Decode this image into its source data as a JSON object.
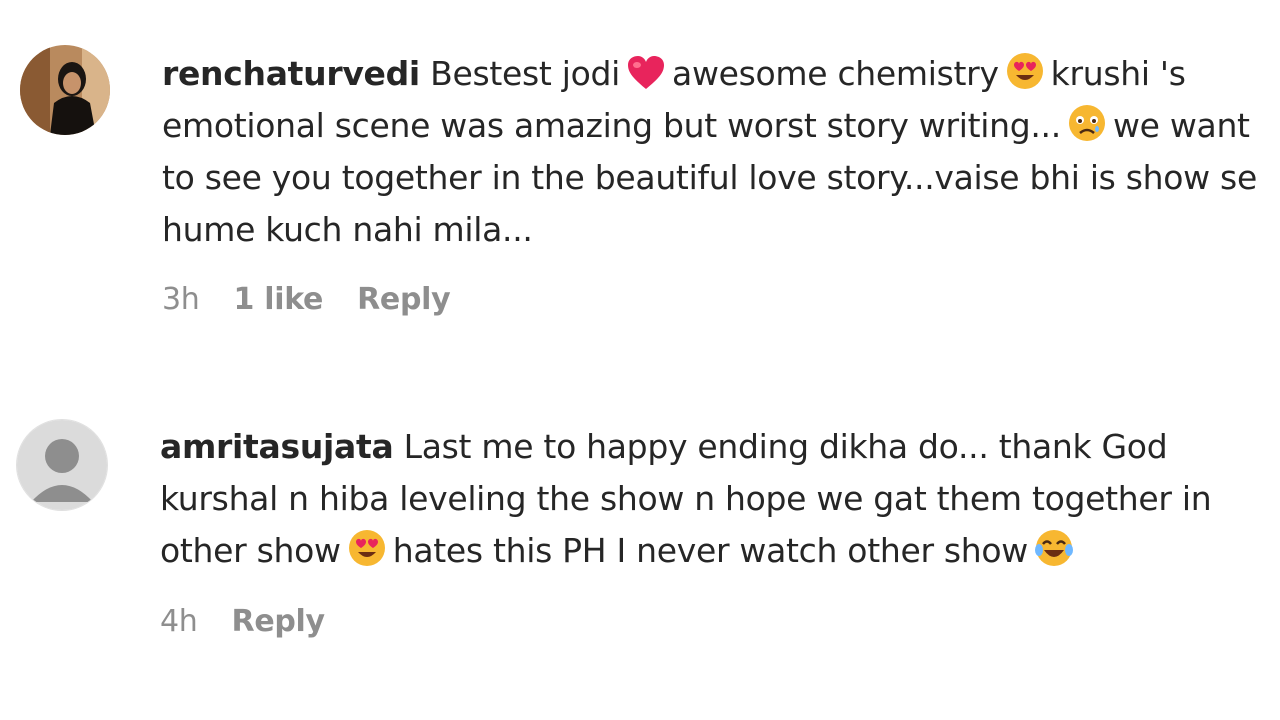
{
  "comments": [
    {
      "username": "renchaturvedi",
      "text_parts": [
        "Bestest jodi",
        "awesome chemistry",
        "krushi 's emotional scene was amazing but worst story writing...",
        "we want to see you together in the beautiful love story...vaise bhi is show se hume kuch nahi mila..."
      ],
      "emojis": [
        "heart-emoji",
        "heart-eyes-emoji",
        "worried-face-emoji"
      ],
      "time": "3h",
      "likes": "1 like",
      "reply_label": "Reply",
      "avatar": "profile-photo"
    },
    {
      "username": "amritasujata",
      "text_parts": [
        "Last me to happy ending dikha do... thank God kurshal n hiba leveling the show n hope we gat them together in other show",
        "hates this PH I never watch other show"
      ],
      "emojis": [
        "heart-eyes-emoji",
        "tears-of-joy-emoji"
      ],
      "time": "4h",
      "reply_label": "Reply",
      "avatar": "default-avatar"
    }
  ],
  "colors": {
    "text": "#262626",
    "meta": "#8e8e8e",
    "avatar_bg": "#dbdbdb",
    "avatar_fg": "#8e8e8e"
  }
}
